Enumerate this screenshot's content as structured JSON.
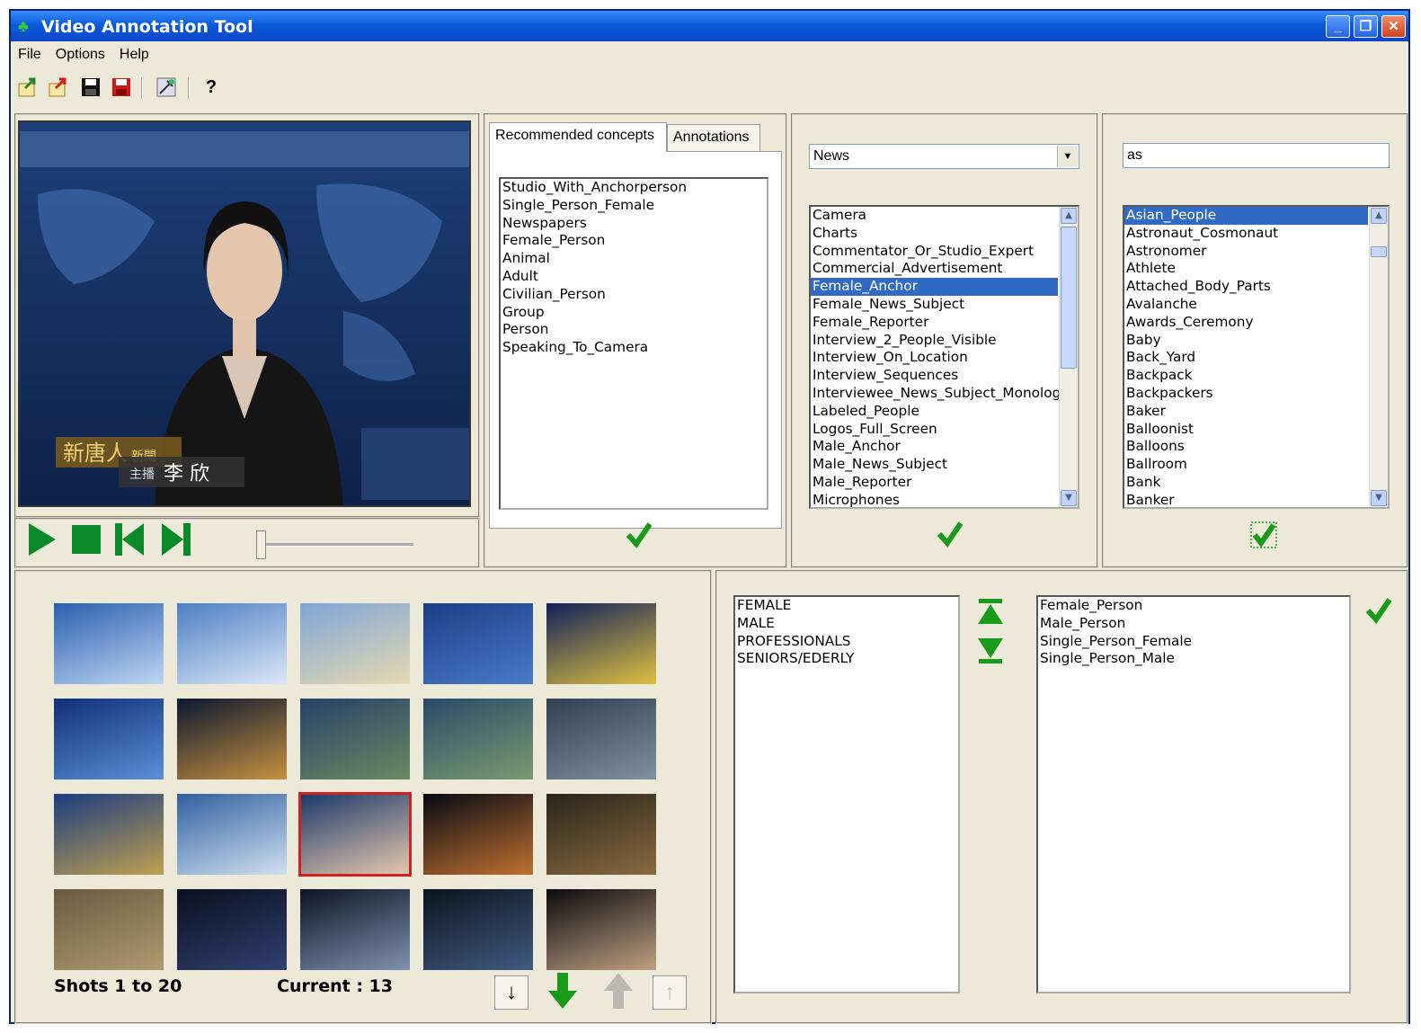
{
  "window": {
    "title": "Video Annotation Tool"
  },
  "menu": [
    "File",
    "Options",
    "Help"
  ],
  "toolbar": {
    "help_label": "?"
  },
  "tabs": {
    "recommended": "Recommended concepts",
    "annotations": "Annotations"
  },
  "recommended_concepts": [
    "Studio_With_Anchorperson",
    "Single_Person_Female",
    "Newspapers",
    "Female_Person",
    "Animal",
    "Adult",
    "Civilian_Person",
    "Group",
    "Person",
    "Speaking_To_Camera"
  ],
  "category": {
    "selected": "News",
    "items": [
      "Camera",
      "Charts",
      "Commentator_Or_Studio_Expert",
      "Commercial_Advertisement",
      "Female_Anchor",
      "Female_News_Subject",
      "Female_Reporter",
      "Interview_2_People_Visible",
      "Interview_On_Location",
      "Interview_Sequences",
      "Interviewee_News_Subject_Monolog",
      "Labeled_People",
      "Logos_Full_Screen",
      "Male_Anchor",
      "Male_News_Subject",
      "Male_Reporter",
      "Microphones"
    ],
    "selected_item": "Female_Anchor"
  },
  "search": {
    "value": "as",
    "items": [
      "Asian_People",
      "Astronaut_Cosmonaut",
      "Astronomer",
      "Athlete",
      "Attached_Body_Parts",
      "Avalanche",
      "Awards_Ceremony",
      "Baby",
      "Back_Yard",
      "Backpack",
      "Backpackers",
      "Baker",
      "Balloonist",
      "Balloons",
      "Ballroom",
      "Bank",
      "Banker"
    ],
    "selected_item": "Asian_People"
  },
  "groups_list": [
    "FEMALE",
    "MALE",
    "PROFESSIONALS",
    "SENIORS/EDERLY"
  ],
  "group_concepts": [
    "Female_Person",
    "Male_Person",
    "Single_Person_Female",
    "Single_Person_Male"
  ],
  "shots": {
    "range_label": "Shots 1 to 20",
    "current_label": "Current : 13"
  },
  "video": {
    "station_text": "新唐人",
    "station_sub": "新聞",
    "anchor_label": "主播",
    "anchor_name": "李 欣"
  }
}
